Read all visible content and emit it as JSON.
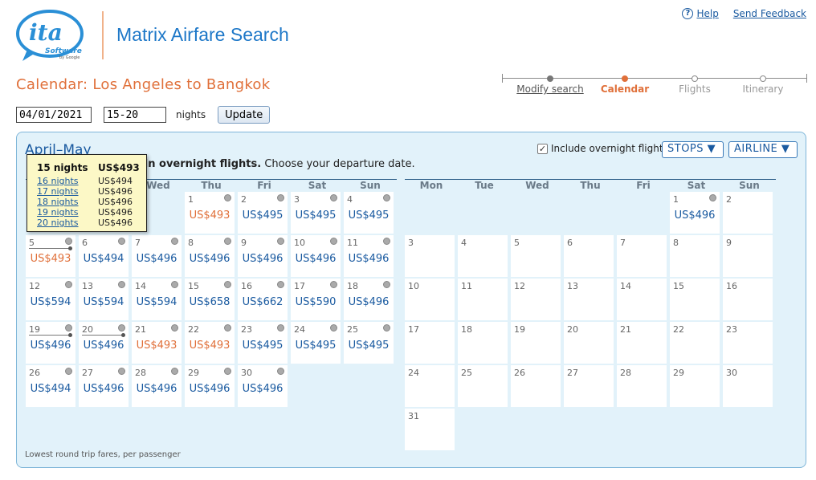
{
  "header": {
    "logo_text": "ita Software by Google",
    "title": "Matrix Airfare Search",
    "help": "Help",
    "feedback": "Send Feedback"
  },
  "page": {
    "heading": "Calendar: Los Angeles to Bangkok"
  },
  "steps": [
    "Modify search",
    "Calendar",
    "Flights",
    "Itinerary"
  ],
  "form": {
    "date": "04/01/2021",
    "nights": "15-20",
    "nights_label": "nights",
    "update": "Update"
  },
  "panel": {
    "month": "April–May",
    "info_bold": "ain overnight flights.",
    "info_rest": " Choose your departure date.",
    "overnight_label": "Include overnight flights",
    "stops": "STOPS ▼",
    "airline": "AIRLINE ▼",
    "footnote": "Lowest round trip fares, per passenger"
  },
  "weekdays": [
    "Mon",
    "Tue",
    "Wed",
    "Thu",
    "Fri",
    "Sat",
    "Sun"
  ],
  "april_cells": [
    {
      "d": "1",
      "p": "US$493",
      "c": true,
      "row": 0,
      "col": 3
    },
    {
      "d": "2",
      "p": "US$495",
      "c": false,
      "row": 0,
      "col": 4
    },
    {
      "d": "3",
      "p": "US$495",
      "c": false,
      "row": 0,
      "col": 5
    },
    {
      "d": "4",
      "p": "US$495",
      "c": false,
      "row": 0,
      "col": 6
    },
    {
      "d": "5",
      "p": "US$493",
      "c": true,
      "row": 1,
      "col": 0
    },
    {
      "d": "6",
      "p": "US$494",
      "c": false,
      "row": 1,
      "col": 1
    },
    {
      "d": "7",
      "p": "US$496",
      "c": false,
      "row": 1,
      "col": 2
    },
    {
      "d": "8",
      "p": "US$496",
      "c": false,
      "row": 1,
      "col": 3
    },
    {
      "d": "9",
      "p": "US$496",
      "c": false,
      "row": 1,
      "col": 4
    },
    {
      "d": "10",
      "p": "US$496",
      "c": false,
      "row": 1,
      "col": 5
    },
    {
      "d": "11",
      "p": "US$496",
      "c": false,
      "row": 1,
      "col": 6
    },
    {
      "d": "12",
      "p": "US$594",
      "c": false,
      "row": 2,
      "col": 0
    },
    {
      "d": "13",
      "p": "US$594",
      "c": false,
      "row": 2,
      "col": 1
    },
    {
      "d": "14",
      "p": "US$594",
      "c": false,
      "row": 2,
      "col": 2
    },
    {
      "d": "15",
      "p": "US$658",
      "c": false,
      "row": 2,
      "col": 3
    },
    {
      "d": "16",
      "p": "US$662",
      "c": false,
      "row": 2,
      "col": 4
    },
    {
      "d": "17",
      "p": "US$590",
      "c": false,
      "row": 2,
      "col": 5
    },
    {
      "d": "18",
      "p": "US$496",
      "c": false,
      "row": 2,
      "col": 6
    },
    {
      "d": "19",
      "p": "US$496",
      "c": false,
      "row": 3,
      "col": 0
    },
    {
      "d": "20",
      "p": "US$496",
      "c": false,
      "row": 3,
      "col": 1
    },
    {
      "d": "21",
      "p": "US$493",
      "c": true,
      "row": 3,
      "col": 2
    },
    {
      "d": "22",
      "p": "US$493",
      "c": true,
      "row": 3,
      "col": 3
    },
    {
      "d": "23",
      "p": "US$495",
      "c": false,
      "row": 3,
      "col": 4
    },
    {
      "d": "24",
      "p": "US$495",
      "c": false,
      "row": 3,
      "col": 5
    },
    {
      "d": "25",
      "p": "US$495",
      "c": false,
      "row": 3,
      "col": 6
    },
    {
      "d": "26",
      "p": "US$494",
      "c": false,
      "row": 4,
      "col": 0
    },
    {
      "d": "27",
      "p": "US$496",
      "c": false,
      "row": 4,
      "col": 1
    },
    {
      "d": "28",
      "p": "US$496",
      "c": false,
      "row": 4,
      "col": 2
    },
    {
      "d": "29",
      "p": "US$496",
      "c": false,
      "row": 4,
      "col": 3
    },
    {
      "d": "30",
      "p": "US$496",
      "c": false,
      "row": 4,
      "col": 4
    }
  ],
  "may_cells": [
    {
      "d": "1",
      "p": "US$496",
      "row": 0,
      "col": 5
    },
    {
      "d": "2",
      "p": "",
      "row": 0,
      "col": 6
    },
    {
      "d": "3",
      "p": "",
      "row": 1,
      "col": 0
    },
    {
      "d": "4",
      "p": "",
      "row": 1,
      "col": 1
    },
    {
      "d": "5",
      "p": "",
      "row": 1,
      "col": 2
    },
    {
      "d": "6",
      "p": "",
      "row": 1,
      "col": 3
    },
    {
      "d": "7",
      "p": "",
      "row": 1,
      "col": 4
    },
    {
      "d": "8",
      "p": "",
      "row": 1,
      "col": 5
    },
    {
      "d": "9",
      "p": "",
      "row": 1,
      "col": 6
    },
    {
      "d": "10",
      "p": "",
      "row": 2,
      "col": 0
    },
    {
      "d": "11",
      "p": "",
      "row": 2,
      "col": 1
    },
    {
      "d": "12",
      "p": "",
      "row": 2,
      "col": 2
    },
    {
      "d": "13",
      "p": "",
      "row": 2,
      "col": 3
    },
    {
      "d": "14",
      "p": "",
      "row": 2,
      "col": 4
    },
    {
      "d": "15",
      "p": "",
      "row": 2,
      "col": 5
    },
    {
      "d": "16",
      "p": "",
      "row": 2,
      "col": 6
    },
    {
      "d": "17",
      "p": "",
      "row": 3,
      "col": 0
    },
    {
      "d": "18",
      "p": "",
      "row": 3,
      "col": 1
    },
    {
      "d": "19",
      "p": "",
      "row": 3,
      "col": 2
    },
    {
      "d": "20",
      "p": "",
      "row": 3,
      "col": 3
    },
    {
      "d": "21",
      "p": "",
      "row": 3,
      "col": 4
    },
    {
      "d": "22",
      "p": "",
      "row": 3,
      "col": 5
    },
    {
      "d": "23",
      "p": "",
      "row": 3,
      "col": 6
    },
    {
      "d": "24",
      "p": "",
      "row": 4,
      "col": 0
    },
    {
      "d": "25",
      "p": "",
      "row": 4,
      "col": 1
    },
    {
      "d": "26",
      "p": "",
      "row": 4,
      "col": 2
    },
    {
      "d": "27",
      "p": "",
      "row": 4,
      "col": 3
    },
    {
      "d": "28",
      "p": "",
      "row": 4,
      "col": 4
    },
    {
      "d": "29",
      "p": "",
      "row": 4,
      "col": 5
    },
    {
      "d": "30",
      "p": "",
      "row": 4,
      "col": 6
    },
    {
      "d": "31",
      "p": "",
      "row": 5,
      "col": 0
    }
  ],
  "tooltip": {
    "head": {
      "label": "15 nights",
      "price": "US$493"
    },
    "rows": [
      {
        "label": "16 nights",
        "price": "US$494"
      },
      {
        "label": "17 nights",
        "price": "US$496"
      },
      {
        "label": "18 nights",
        "price": "US$496"
      },
      {
        "label": "19 nights",
        "price": "US$496"
      },
      {
        "label": "20 nights",
        "price": "US$496"
      }
    ]
  },
  "colors": {
    "accent": "#e0703a",
    "link": "#1a5aa0",
    "panel": "#e2f2fa"
  }
}
